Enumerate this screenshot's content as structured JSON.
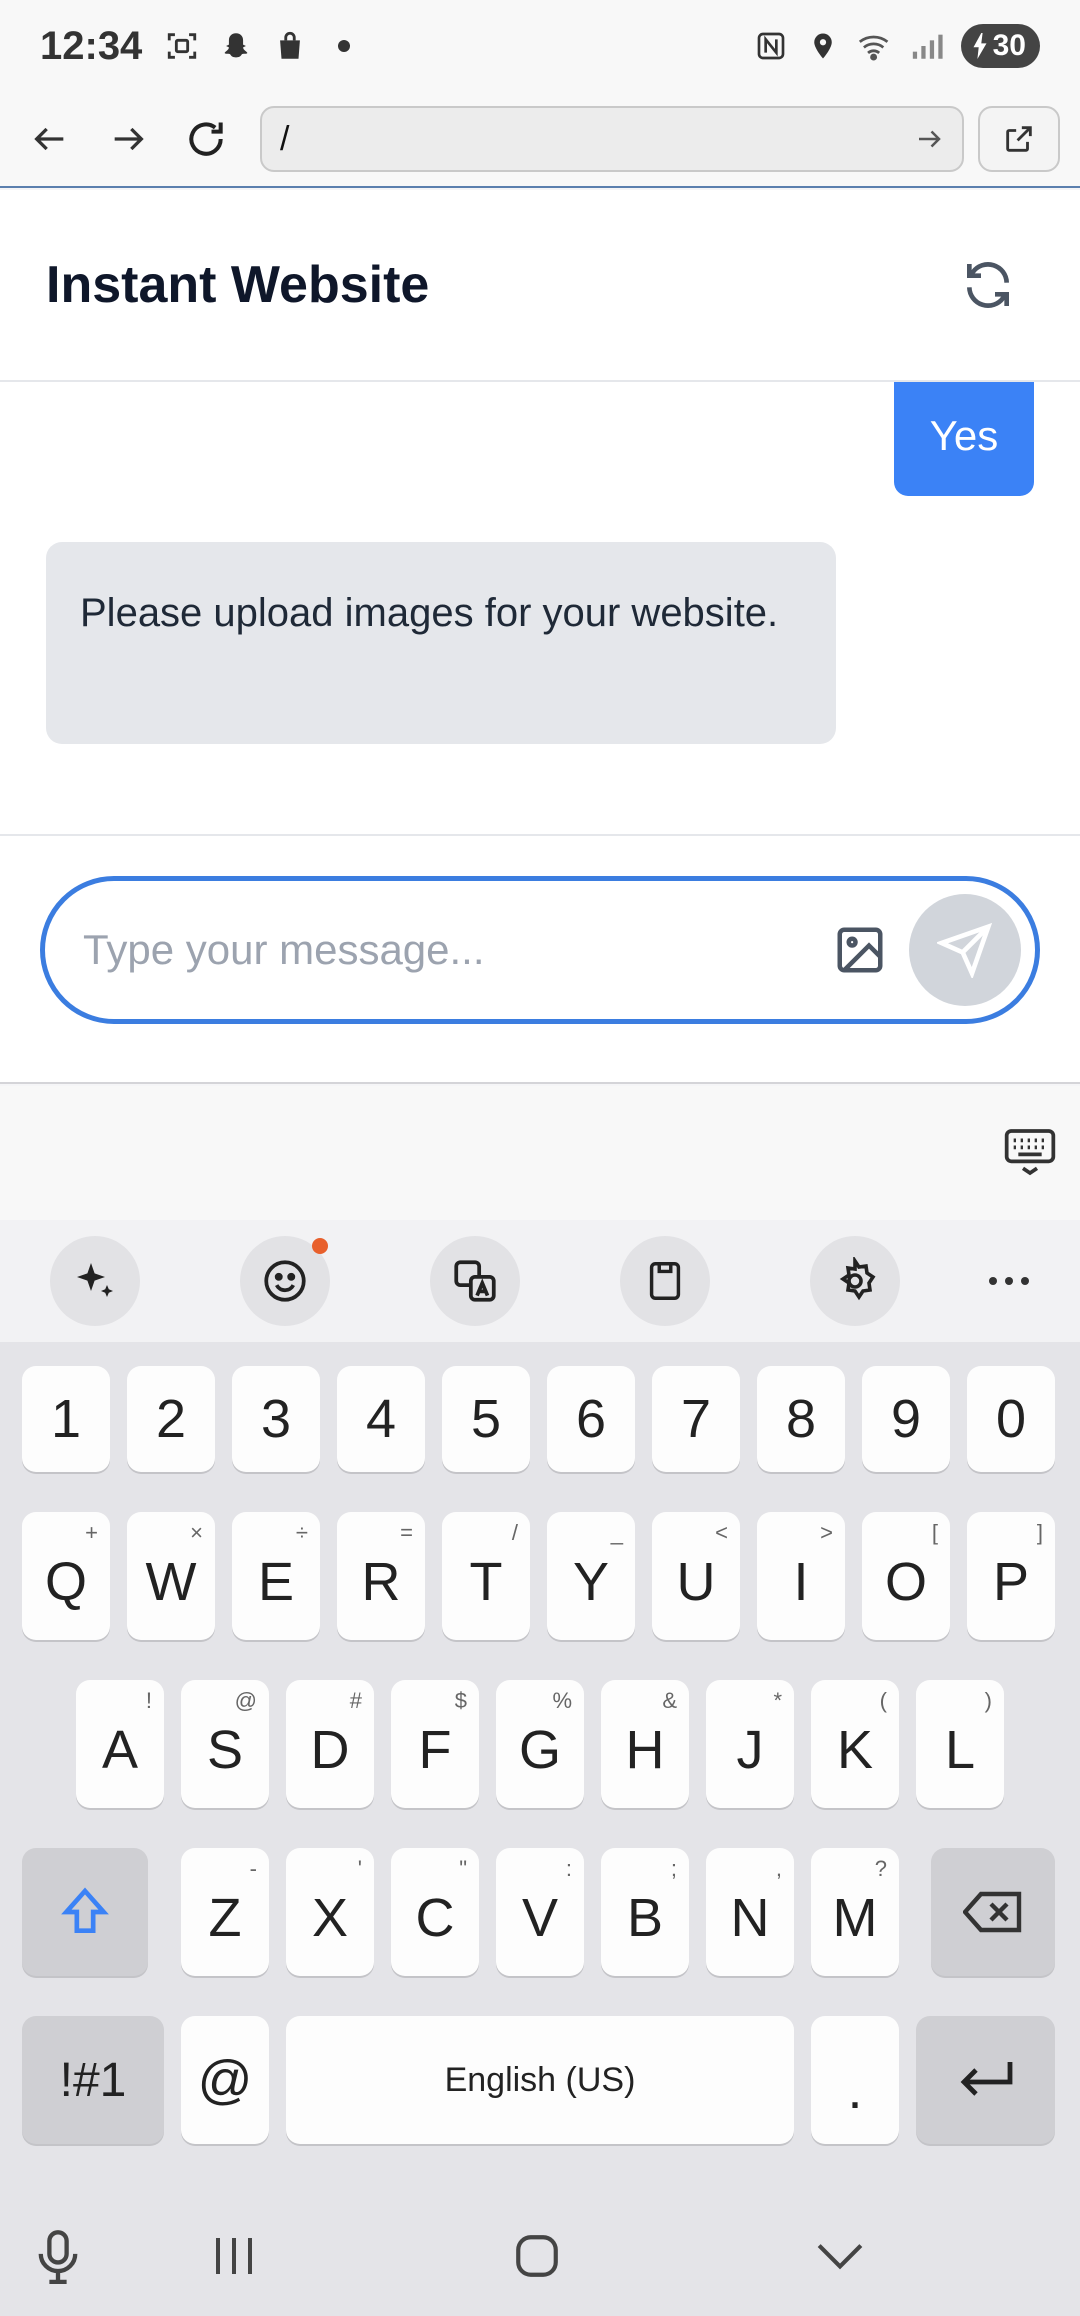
{
  "status_bar": {
    "time": "12:34",
    "battery": "30",
    "icons": [
      "screenshot-icon",
      "snapchat-icon",
      "shopping-bag-icon",
      "dot-icon",
      "nfc-icon",
      "location-icon",
      "wifi-icon",
      "signal-icon",
      "battery-icon"
    ]
  },
  "browser": {
    "url": "/"
  },
  "app": {
    "title": "Instant Website"
  },
  "chat": {
    "messages": [
      {
        "role": "user",
        "text": "Yes"
      },
      {
        "role": "assistant",
        "text": "Please upload images for your website."
      }
    ]
  },
  "composer": {
    "placeholder": "Type your message..."
  },
  "keyboard": {
    "numbers": [
      "1",
      "2",
      "3",
      "4",
      "5",
      "6",
      "7",
      "8",
      "9",
      "0"
    ],
    "row1": [
      {
        "key": "Q",
        "sub": "+"
      },
      {
        "key": "W",
        "sub": "×"
      },
      {
        "key": "E",
        "sub": "÷"
      },
      {
        "key": "R",
        "sub": "="
      },
      {
        "key": "T",
        "sub": "/"
      },
      {
        "key": "Y",
        "sub": "_"
      },
      {
        "key": "U",
        "sub": "<"
      },
      {
        "key": "I",
        "sub": ">"
      },
      {
        "key": "O",
        "sub": "["
      },
      {
        "key": "P",
        "sub": "]"
      }
    ],
    "row2": [
      {
        "key": "A",
        "sub": "!"
      },
      {
        "key": "S",
        "sub": "@"
      },
      {
        "key": "D",
        "sub": "#"
      },
      {
        "key": "F",
        "sub": "$"
      },
      {
        "key": "G",
        "sub": "%"
      },
      {
        "key": "H",
        "sub": "&"
      },
      {
        "key": "J",
        "sub": "*"
      },
      {
        "key": "K",
        "sub": "("
      },
      {
        "key": "L",
        "sub": ")"
      }
    ],
    "row3": [
      {
        "key": "Z",
        "sub": "-"
      },
      {
        "key": "X",
        "sub": "'"
      },
      {
        "key": "C",
        "sub": "\""
      },
      {
        "key": "V",
        "sub": ":"
      },
      {
        "key": "B",
        "sub": ";"
      },
      {
        "key": "N",
        "sub": ","
      },
      {
        "key": "M",
        "sub": "?"
      }
    ],
    "symbols_label": "!#1",
    "at_label": "@",
    "space_label": "English (US)",
    "period_label": "."
  }
}
